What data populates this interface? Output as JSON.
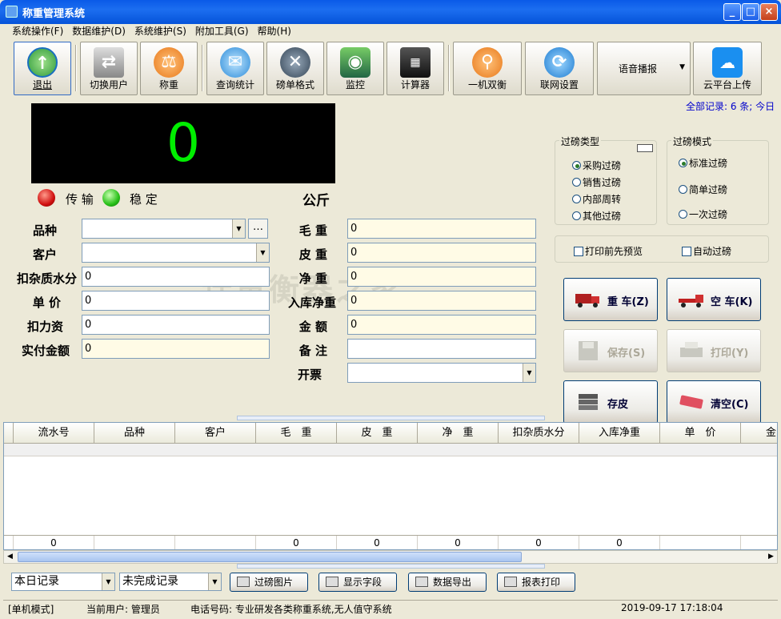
{
  "window": {
    "title": "称重管理系统"
  },
  "menu": [
    "系统操作(F)",
    "数据维护(D)",
    "系统维护(S)",
    "附加工具(G)",
    "帮助(H)"
  ],
  "toolbar": {
    "exit": "退出",
    "switch_user": "切换用户",
    "weigh": "称重",
    "query": "查询统计",
    "ticket_format": "磅单格式",
    "monitor": "监控",
    "calculator": "计算器",
    "dual_balance": "一机双衡",
    "network": "联网设置",
    "voice": "语音播报",
    "cloud": "云平台上传"
  },
  "records_info": "全部记录: 6 条; 今日",
  "display": {
    "value": "0",
    "transmit": "传 输",
    "stable": "稳 定",
    "unit": "公斤"
  },
  "form": {
    "variety_label": "品种",
    "variety_value": "",
    "more": "…",
    "customer_label": "客户",
    "customer_value": "",
    "deduct_label": "扣杂质水分",
    "deduct_value": "0",
    "price_label": "单 价",
    "price_value": "0",
    "fee_label": "扣力资",
    "fee_value": "0",
    "paid_label": "实付金额",
    "paid_value": "0",
    "gross_label": "毛 重",
    "gross_value": "0",
    "tare_label": "皮 重",
    "tare_value": "0",
    "net_label": "净 重",
    "net_value": "0",
    "stock_net_label": "入库净重",
    "stock_net_value": "0",
    "amount_label": "金 额",
    "amount_value": "0",
    "remark_label": "备 注",
    "remark_value": "",
    "invoice_label": "开票",
    "invoice_value": ""
  },
  "weigh_type": {
    "title": "过磅类型",
    "options": [
      "采购过磅",
      "销售过磅",
      "内部周转",
      "其他过磅"
    ],
    "selected": 0
  },
  "weigh_mode": {
    "title": "过磅模式",
    "options": [
      "标准过磅",
      "简单过磅",
      "一次过磅"
    ],
    "selected": 0
  },
  "options": {
    "preview": "打印前先预览",
    "auto": "自动过磅"
  },
  "actions": {
    "heavy": "重 车(Z)",
    "empty": "空 车(K)",
    "save": "保存(S)",
    "print": "打印(Y)",
    "tare": "存皮",
    "clear": "清空(C)"
  },
  "watermark": "计量衡器之家",
  "grid": {
    "headers": [
      "流水号",
      "品种",
      "客户",
      "毛　重",
      "皮　重",
      "净　重",
      "扣杂质水分",
      "入库净重",
      "单　价",
      "金"
    ],
    "totals": [
      "0",
      "",
      "",
      "0",
      "0",
      "0",
      "0",
      "0",
      "",
      ""
    ]
  },
  "bottom": {
    "filter1": "本日记录",
    "filter2": "未完成记录",
    "photos": "过磅图片",
    "fields": "显示字段",
    "export": "数据导出",
    "report": "报表打印"
  },
  "status": {
    "mode": "[单机模式]",
    "user": "当前用户: 管理员",
    "phone": "电话号码: 专业研发各类称重系统,无人值守系统",
    "datetime": "2019-09-17 17:18:04"
  }
}
